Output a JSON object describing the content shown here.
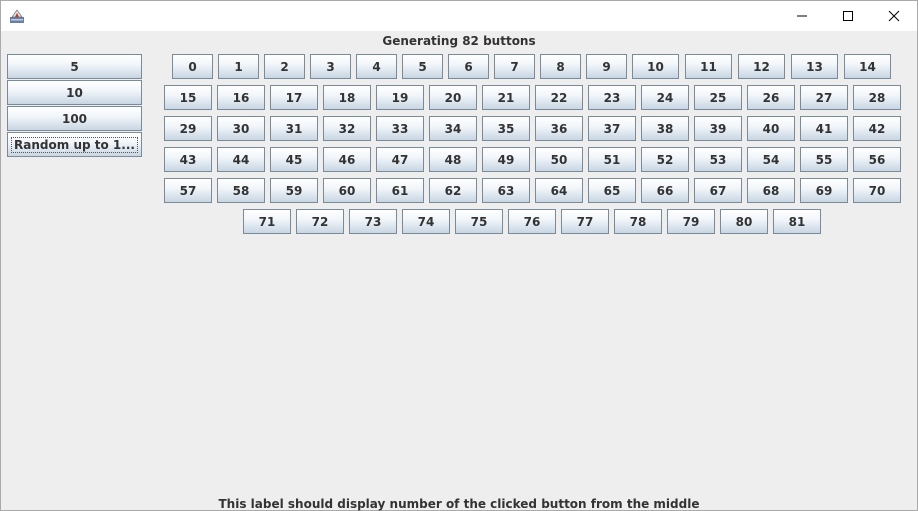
{
  "window": {
    "title": "",
    "controls": {
      "minimize_icon": "minimize-icon",
      "maximize_icon": "maximize-icon",
      "close_icon": "close-icon"
    }
  },
  "heading": "Generating 82 buttons",
  "left_buttons": [
    {
      "label": "5"
    },
    {
      "label": "10"
    },
    {
      "label": "100"
    },
    {
      "label": "Random up to 1..."
    }
  ],
  "grid_buttons": [
    "0",
    "1",
    "2",
    "3",
    "4",
    "5",
    "6",
    "7",
    "8",
    "9",
    "10",
    "11",
    "12",
    "13",
    "14",
    "15",
    "16",
    "17",
    "18",
    "19",
    "20",
    "21",
    "22",
    "23",
    "24",
    "25",
    "26",
    "27",
    "28",
    "29",
    "30",
    "31",
    "32",
    "33",
    "34",
    "35",
    "36",
    "37",
    "38",
    "39",
    "40",
    "41",
    "42",
    "43",
    "44",
    "45",
    "46",
    "47",
    "48",
    "49",
    "50",
    "51",
    "52",
    "53",
    "54",
    "55",
    "56",
    "57",
    "58",
    "59",
    "60",
    "61",
    "62",
    "63",
    "64",
    "65",
    "66",
    "67",
    "68",
    "69",
    "70",
    "71",
    "72",
    "73",
    "74",
    "75",
    "76",
    "77",
    "78",
    "79",
    "80",
    "81"
  ],
  "footer": "This label should display number of the clicked button from the middle",
  "colors": {
    "background": "#eeeeee",
    "button_border": "#7a8a99",
    "text": "#333333"
  }
}
